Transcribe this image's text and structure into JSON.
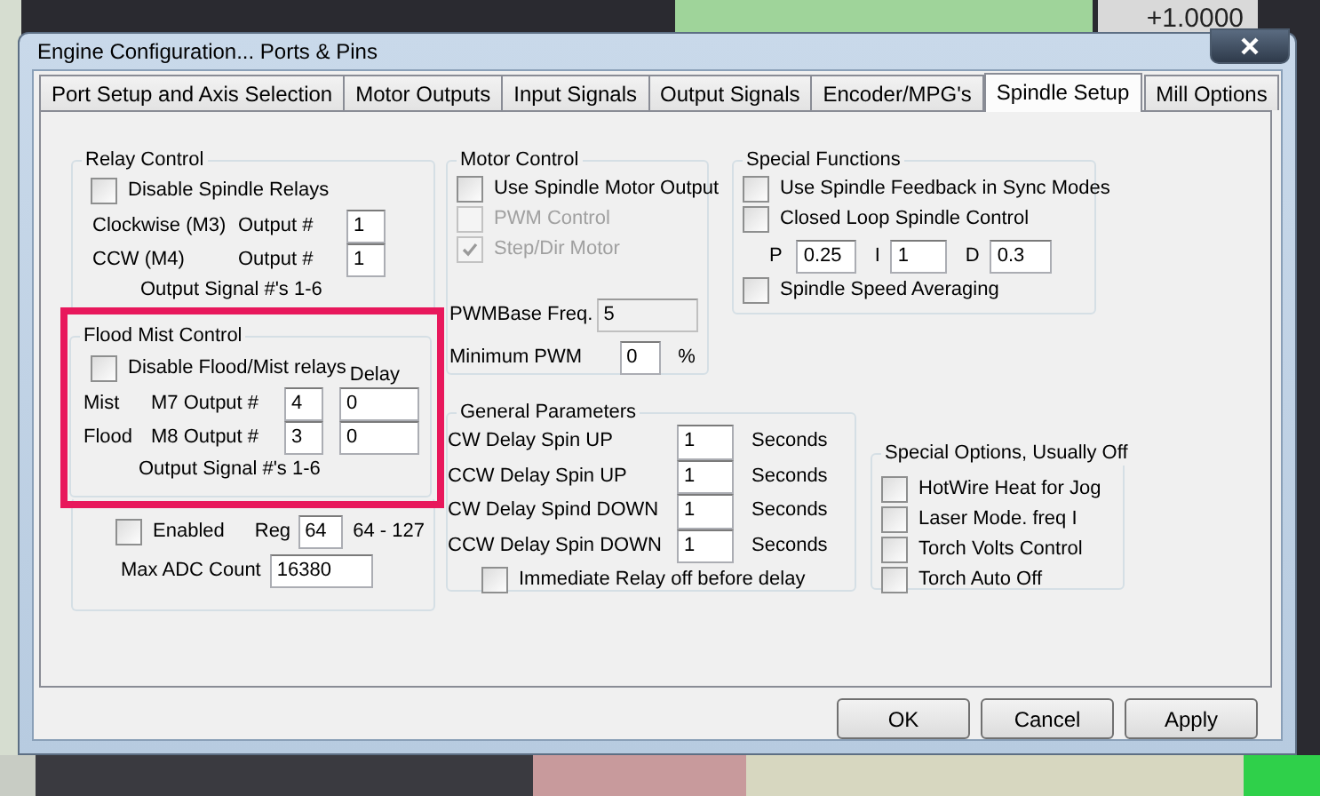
{
  "background": {
    "readout": "+1.0000"
  },
  "window": {
    "title": "Engine Configuration... Ports & Pins"
  },
  "tabs": [
    {
      "label": "Port Setup and Axis Selection",
      "selected": false
    },
    {
      "label": "Motor Outputs",
      "selected": false
    },
    {
      "label": "Input Signals",
      "selected": false
    },
    {
      "label": "Output Signals",
      "selected": false
    },
    {
      "label": "Encoder/MPG's",
      "selected": false
    },
    {
      "label": "Spindle Setup",
      "selected": true
    },
    {
      "label": "Mill Options",
      "selected": false
    }
  ],
  "relay_control": {
    "title": "Relay Control",
    "checkbox": {
      "label": "Disable Spindle Relays",
      "checked": false
    },
    "outputs": [
      {
        "label": "Clockwise (M3)",
        "field_label": "Output #",
        "value": "1"
      },
      {
        "label": "CCW (M4)",
        "field_label": "Output #",
        "value": "1"
      }
    ],
    "note": "Output Signal #'s 1-6"
  },
  "flood_mist_control": {
    "title": "Flood Mist Control",
    "highlighted": true,
    "checkbox": {
      "label": "Disable Flood/Mist relays",
      "checked": false
    },
    "delay_label": "Delay",
    "outputs": [
      {
        "name": "Mist",
        "label": "M7 Output #",
        "value": "4",
        "delay": "0"
      },
      {
        "name": "Flood",
        "label": "M8 Output #",
        "value": "3",
        "delay": "0"
      }
    ],
    "note": "Output Signal #'s 1-6"
  },
  "modbus_spindle": {
    "enabled": {
      "label": "Enabled",
      "checked": false
    },
    "reg_label": "Reg",
    "reg_value": "64",
    "reg_range": "64 - 127",
    "max_adc_label": "Max ADC Count",
    "max_adc_value": "16380"
  },
  "motor_control": {
    "title": "Motor Control",
    "checkboxes": [
      {
        "label": "Use Spindle Motor Output",
        "checked": false,
        "disabled": false
      },
      {
        "label": "PWM Control",
        "checked": false,
        "disabled": true
      },
      {
        "label": "Step/Dir Motor",
        "checked": true,
        "disabled": true
      }
    ],
    "pwm_base": {
      "label": "PWMBase Freq.",
      "value": "5",
      "disabled": true
    },
    "min_pwm": {
      "label": "Minimum PWM",
      "value": "0",
      "unit": "%"
    }
  },
  "special_functions": {
    "title": "Special Functions",
    "checkboxes": [
      {
        "label": "Use Spindle Feedback in Sync Modes",
        "checked": false
      },
      {
        "label": "Closed Loop Spindle Control",
        "checked": false
      }
    ],
    "pid": [
      {
        "label": "P",
        "value": "0.25"
      },
      {
        "label": "I",
        "value": "1"
      },
      {
        "label": "D",
        "value": "0.3"
      }
    ],
    "averaging": {
      "label": "Spindle Speed Averaging",
      "checked": false
    }
  },
  "general_parameters": {
    "title": "General Parameters",
    "rows": [
      {
        "label": "CW Delay Spin UP",
        "value": "1",
        "unit": "Seconds"
      },
      {
        "label": "CCW Delay Spin UP",
        "value": "1",
        "unit": "Seconds"
      },
      {
        "label": "CW Delay Spind DOWN",
        "value": "1",
        "unit": "Seconds"
      },
      {
        "label": "CCW Delay Spin DOWN",
        "value": "1",
        "unit": "Seconds"
      }
    ],
    "checkbox": {
      "label": "Immediate Relay off before delay",
      "checked": false
    }
  },
  "special_options": {
    "title": "Special Options, Usually Off",
    "checkboxes": [
      {
        "label": "HotWire Heat for Jog",
        "checked": false
      },
      {
        "label": "Laser Mode. freq I",
        "checked": false
      },
      {
        "label": "Torch Volts Control",
        "checked": false
      },
      {
        "label": "Torch Auto Off",
        "checked": false
      }
    ]
  },
  "buttons": [
    {
      "label": "OK"
    },
    {
      "label": "Cancel"
    },
    {
      "label": "Apply"
    }
  ]
}
